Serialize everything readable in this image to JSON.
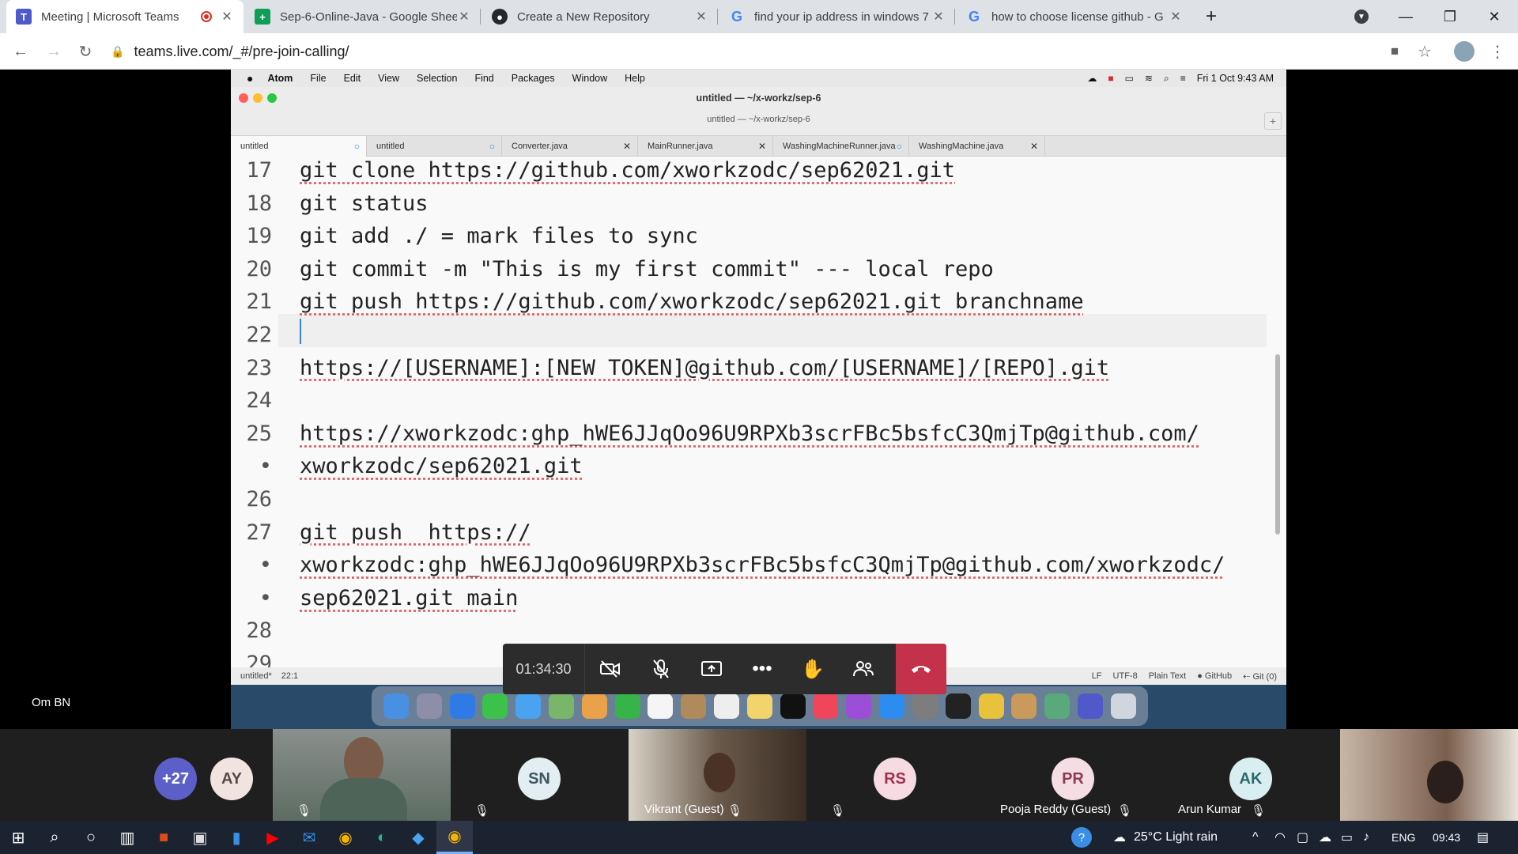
{
  "browser": {
    "tabs": [
      {
        "title": "Meeting | Microsoft Teams",
        "favicon": "teams-icon",
        "active": true,
        "recording": true
      },
      {
        "title": "Sep-6-Online-Java - Google Shee",
        "favicon": "google-sheets-icon",
        "active": false
      },
      {
        "title": "Create a New Repository",
        "favicon": "github-icon",
        "active": false
      },
      {
        "title": "find your ip address in windows 7",
        "favicon": "google-icon",
        "active": false
      },
      {
        "title": "how to choose license github - G",
        "favicon": "google-icon",
        "active": false
      }
    ],
    "url": "teams.live.com/_#/pre-join-calling/"
  },
  "mac_menubar": {
    "app": "Atom",
    "menus": [
      "File",
      "Edit",
      "View",
      "Selection",
      "Find",
      "Packages",
      "Window",
      "Help"
    ],
    "clock": "Fri 1 Oct  9:43 AM"
  },
  "atom": {
    "window_title": "untitled — ~/x-workz/sep-6",
    "window_subtitle": "untitled — ~/x-workz/sep-6",
    "tabs": [
      {
        "label": "untitled",
        "active": true,
        "modified": true
      },
      {
        "label": "untitled",
        "active": false,
        "modified": true
      },
      {
        "label": "Converter.java",
        "active": false,
        "modified": false
      },
      {
        "label": "MainRunner.java",
        "active": false,
        "modified": false
      },
      {
        "label": "WashingMachineRunner.java",
        "active": false,
        "modified": true
      },
      {
        "label": "WashingMachine.java",
        "active": false,
        "modified": false
      }
    ],
    "lines": [
      {
        "num": "17",
        "text": "git clone https://github.com/xworkzodc/sep62021.git"
      },
      {
        "num": "18",
        "text": "git status"
      },
      {
        "num": "19",
        "text": "git add ./ = mark files to sync"
      },
      {
        "num": "20",
        "text": "git commit -m \"This is my first commit\" --- local repo"
      },
      {
        "num": "21",
        "text": "git push https://github.com/xworkzodc/sep62021.git branchname"
      },
      {
        "num": "22",
        "text": ""
      },
      {
        "num": "23",
        "text": "https://[USERNAME]:[NEW TOKEN]@github.com/[USERNAME]/[REPO].git"
      },
      {
        "num": "24",
        "text": ""
      },
      {
        "num": "25",
        "text": "https://xworkzodc: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@github.com/"
      },
      {
        "num": "•",
        "text": "xworkzodc/sep62021.git"
      },
      {
        "num": "26",
        "text": ""
      },
      {
        "num": "27",
        "text": "git push  https://"
      },
      {
        "num": "•",
        "text": "xworkzodc: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@github.com/xworkzodc/"
      },
      {
        "num": "•",
        "text": "sep62021.git main"
      },
      {
        "num": "28",
        "text": ""
      },
      {
        "num": "29",
        "text": ""
      }
    ],
    "status_left": "untitled*",
    "cursor_pos": "22:1",
    "status_right": [
      "LF",
      "UTF-8",
      "Plain Text",
      "GitHub",
      "Git (0)"
    ]
  },
  "call": {
    "timer": "01:34:30",
    "presenter": "Om BN"
  },
  "participants": [
    {
      "initials": "+27",
      "name": "",
      "bg": "#5b5fc7",
      "fg": "#ffffff"
    },
    {
      "initials": "AY",
      "name": "",
      "bg": "#f1e4e0",
      "fg": "#5a4a45"
    },
    {
      "initials": "",
      "name": "",
      "video": true
    },
    {
      "initials": "SN",
      "name": "",
      "bg": "#e3eef2",
      "fg": "#3d5660"
    },
    {
      "initials": "",
      "name": "Vikrant (Guest)",
      "video": true
    },
    {
      "initials": "RS",
      "name": "",
      "bg": "#f7dbe3",
      "fg": "#a0324f"
    },
    {
      "initials": "PR",
      "name": "Pooja Reddy (Guest)",
      "bg": "#f4dde3",
      "fg": "#8d3a52"
    },
    {
      "initials": "AK",
      "name": "Arun Kumar",
      "bg": "#d9eef0",
      "fg": "#2f6870"
    },
    {
      "initials": "",
      "name": "",
      "video": true
    }
  ],
  "taskbar": {
    "weather": "25°C  Light rain",
    "lang": "ENG",
    "time": "09:43"
  }
}
